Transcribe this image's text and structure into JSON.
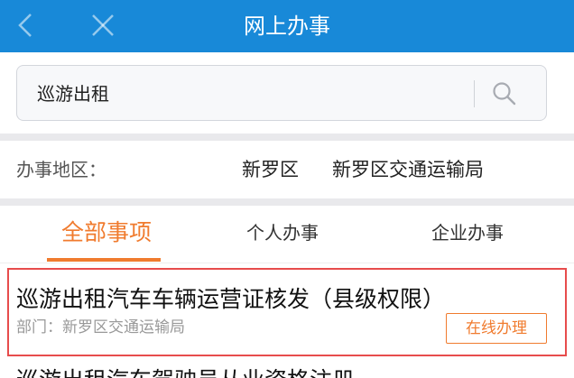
{
  "header": {
    "title": "网上办事",
    "back_icon": "chevron-left-icon",
    "close_icon": "close-icon",
    "bg_color": "#1889d8"
  },
  "search": {
    "value": "巡游出租",
    "icon": "search-icon"
  },
  "region": {
    "label": "办事地区：",
    "district": "新罗区",
    "bureau": "新罗区交通运输局"
  },
  "tabs": [
    {
      "label": "全部事项",
      "active": true
    },
    {
      "label": "个人办事",
      "active": false
    },
    {
      "label": "企业办事",
      "active": false
    }
  ],
  "accent_color": "#f07b2e",
  "items": [
    {
      "title": "巡游出租汽车车辆运营证核发（县级权限）",
      "department": "部门：新罗区交通运输局",
      "action": "在线办理"
    },
    {
      "title": "巡游出租汽车驾驶员从业资格注册"
    }
  ]
}
